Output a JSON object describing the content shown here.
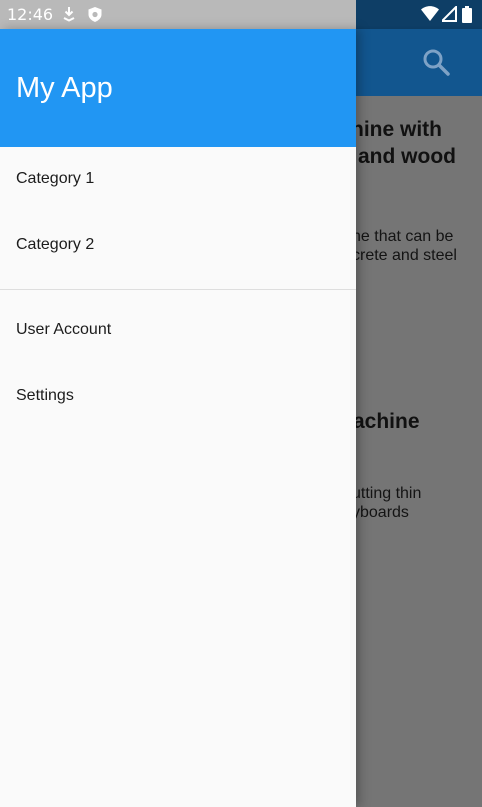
{
  "status_bar": {
    "time": "12:46",
    "left_icons": [
      "download-icon",
      "shield-icon"
    ],
    "right_icons": [
      "wifi-icon",
      "signal-icon",
      "battery-icon"
    ],
    "colors": {
      "left_bg": "#b9b9b9",
      "right_bg": "#0e3e66"
    }
  },
  "drawer": {
    "title": "My App",
    "header_color": "#2196f3",
    "items": [
      {
        "label": "Category 1"
      },
      {
        "label": "Category 2"
      },
      {
        "label": "User Account"
      },
      {
        "label": "Settings"
      }
    ]
  },
  "background": {
    "appbar_icon": "search-icon",
    "article_1": {
      "title_line_1": "hine with",
      "title_line_2": "and wood",
      "body_line_1": "ne that can be",
      "body_line_2": "crete and steel"
    },
    "article_2": {
      "title_line_1": "achine",
      "body_line_1": "utting thin",
      "body_line_2": "yboards"
    },
    "scrim_color": "#757575"
  }
}
